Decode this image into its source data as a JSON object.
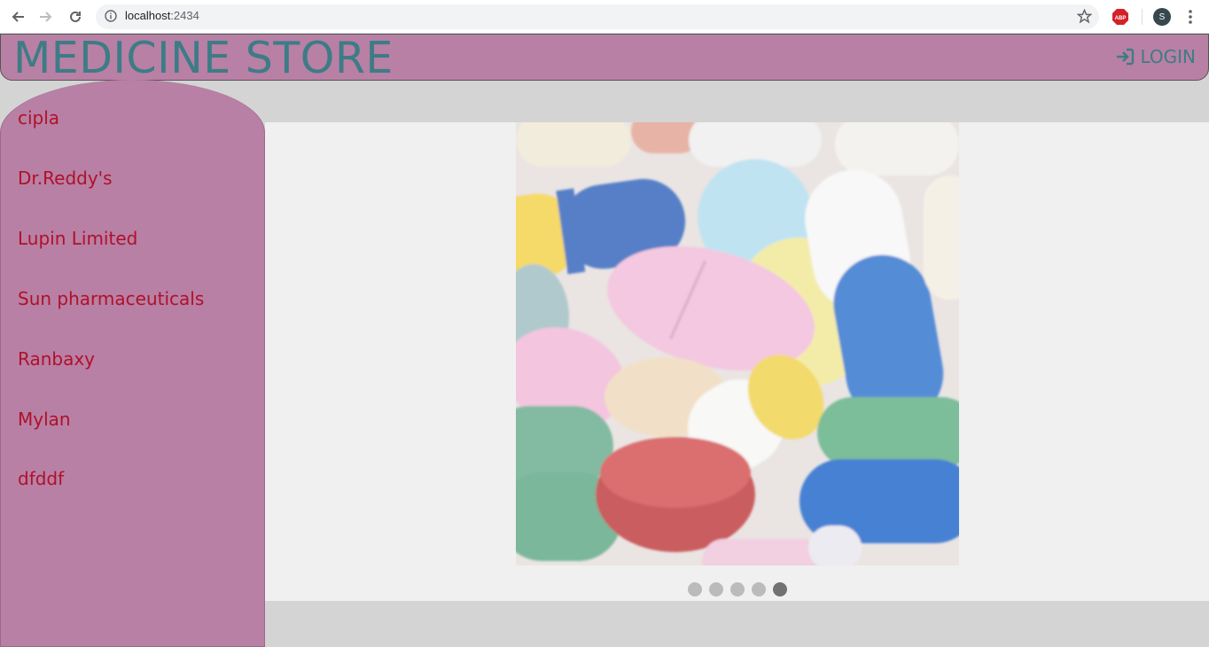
{
  "browser": {
    "url_host": "localhost",
    "url_port": ":2434",
    "avatar_letter": "S"
  },
  "header": {
    "title": "MEDICINE STORE",
    "login_label": "LOGIN"
  },
  "sidebar": {
    "items": [
      {
        "label": "cipla"
      },
      {
        "label": "Dr.Reddy's"
      },
      {
        "label": "Lupin Limited"
      },
      {
        "label": "Sun pharmaceuticals"
      },
      {
        "label": "Ranbaxy"
      },
      {
        "label": "Mylan"
      },
      {
        "label": "dfddf"
      }
    ]
  },
  "slideshow": {
    "image_icon": "pills-photo",
    "dot_count": 5,
    "active_index": 4
  },
  "colors": {
    "header_bg": "#b880a4",
    "title_color": "#3d7c86",
    "link_color": "#b0102a"
  }
}
